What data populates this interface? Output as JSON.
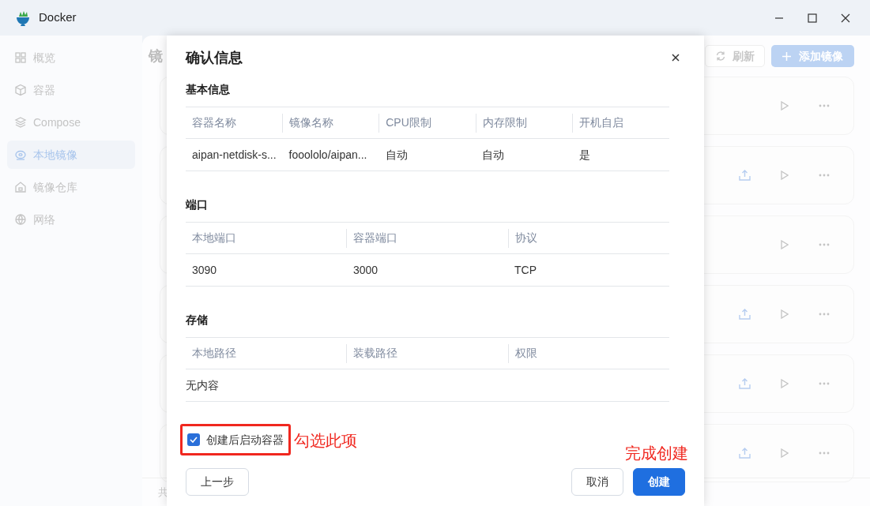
{
  "window": {
    "title": "Docker"
  },
  "sidebar": {
    "items": [
      {
        "label": "概览",
        "selected": false
      },
      {
        "label": "容器",
        "selected": false
      },
      {
        "label": "Compose",
        "selected": false
      },
      {
        "label": "本地镜像",
        "selected": true
      },
      {
        "label": "镜像仓库",
        "selected": false
      },
      {
        "label": "网络",
        "selected": false
      }
    ]
  },
  "page": {
    "heading": "镜",
    "footer": "共",
    "toolbar": [
      {
        "label": "刷新",
        "kind": "refresh"
      },
      {
        "label": "添加镜像",
        "kind": "add"
      }
    ],
    "cards": [
      {
        "has_upload": false
      },
      {
        "has_upload": true
      },
      {
        "has_upload": false
      },
      {
        "has_upload": true
      },
      {
        "has_upload": true
      },
      {
        "has_upload": true
      }
    ]
  },
  "dialog": {
    "title": "确认信息",
    "sections": [
      {
        "title": "基本信息",
        "columns": [
          "容器名称",
          "镜像名称",
          "CPU限制",
          "内存限制",
          "开机自启"
        ],
        "rows": [
          [
            "aipan-netdisk-s...",
            "fooololo/aipan...",
            "自动",
            "自动",
            "是"
          ]
        ]
      },
      {
        "title": "端口",
        "columns": [
          "本地端口",
          "容器端口",
          "协议"
        ],
        "rows": [
          [
            "3090",
            "3000",
            "TCP"
          ]
        ]
      },
      {
        "title": "存储",
        "columns": [
          "本地路径",
          "装载路径",
          "权限"
        ],
        "empty_text": "无内容"
      }
    ],
    "start_after_create": {
      "label": "创建后启动容器",
      "checked": true
    },
    "buttons": [
      {
        "label": "上一步",
        "kind": "secondary"
      },
      {
        "label": "取消",
        "kind": "secondary"
      },
      {
        "label": "创建",
        "kind": "primary"
      }
    ]
  },
  "annotations": [
    {
      "text": "勾选此项"
    },
    {
      "text": "完成创建"
    }
  ]
}
